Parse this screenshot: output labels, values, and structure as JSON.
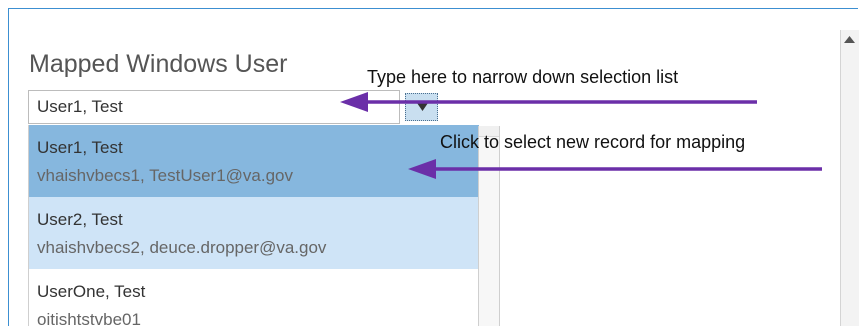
{
  "field": {
    "label": "Mapped Windows User",
    "value": "User1, Test"
  },
  "dropdown": {
    "options": [
      {
        "name": "User1, Test",
        "detail": "vhaishvbecs1, TestUser1@va.gov",
        "state": "selected"
      },
      {
        "name": "User2, Test",
        "detail": "vhaishvbecs2, deuce.dropper@va.gov",
        "state": "hover"
      },
      {
        "name": "UserOne, Test",
        "detail": "oitishtstvbe01",
        "state": "normal"
      }
    ]
  },
  "annotations": {
    "type_hint": "Type here to narrow down selection list",
    "click_hint": "Click to select new record for mapping"
  },
  "icons": {
    "toggle": "triangle-down-icon",
    "scroll_up": "scroll-up-arrow-icon"
  },
  "colors": {
    "frame_border": "#3c8fd1",
    "selected_option": "#86b7de",
    "hover_option": "#cfe4f7",
    "annotation_arrow": "#6b2fa8"
  }
}
